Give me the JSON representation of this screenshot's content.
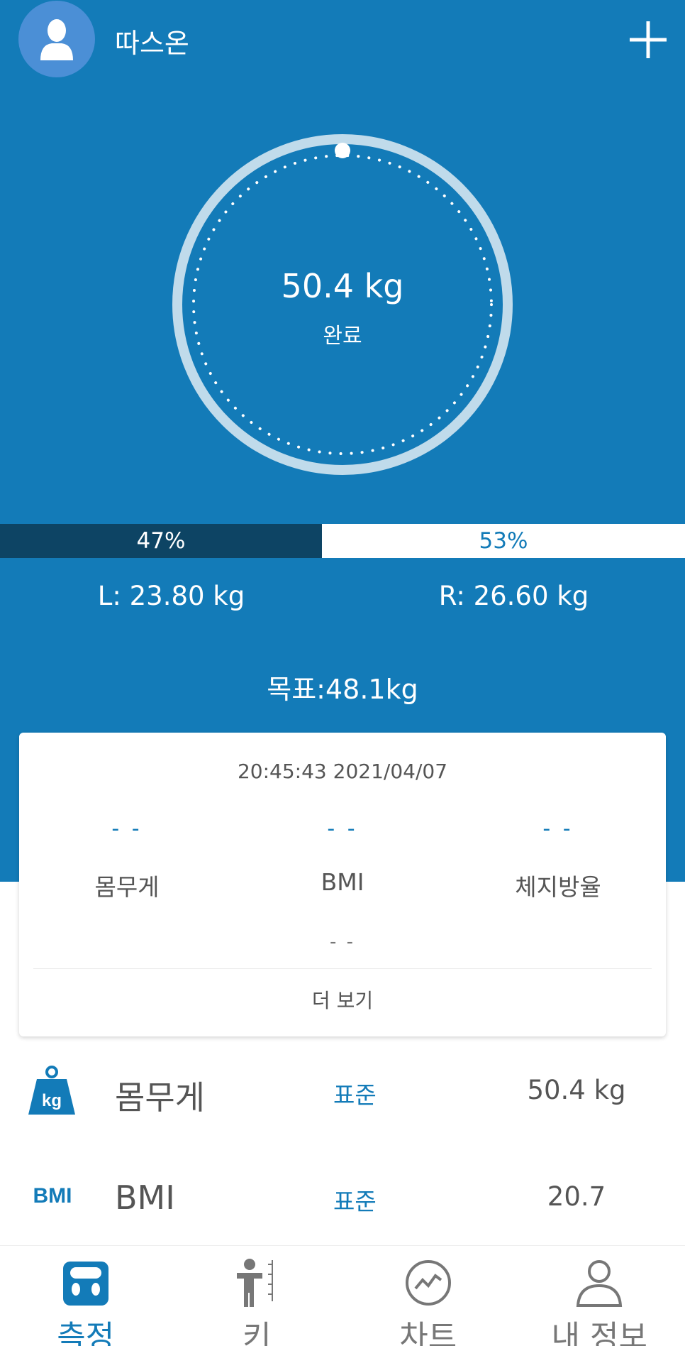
{
  "header": {
    "username": "따스온",
    "add_icon": "plus-icon",
    "avatar_icon": "person-silhouette-icon"
  },
  "measurement": {
    "weight": "50.4 kg",
    "status": "완료",
    "left_percent": "47%",
    "right_percent": "53%",
    "left_fraction": 0.47,
    "left_weight": "L: 23.80 kg",
    "right_weight": "R: 26.60 kg",
    "goal": "목표:48.1kg"
  },
  "card": {
    "timestamp": "20:45:43 2021/04/07",
    "columns": [
      {
        "value": "- -",
        "label": "몸무게"
      },
      {
        "value": "- -",
        "label": "BMI"
      },
      {
        "value": "- -",
        "label": "체지방율"
      }
    ],
    "extra": "- -",
    "more": "더 보기"
  },
  "metrics": [
    {
      "icon": "kg-weight-icon",
      "name": "몸무게",
      "status": "표준",
      "value": "50.4 kg"
    },
    {
      "icon": "bmi-icon",
      "icon_text": "BMI",
      "name": "BMI",
      "status": "표준",
      "value": "20.7"
    }
  ],
  "nav": [
    {
      "label": "측정",
      "icon": "scale-icon",
      "active": true
    },
    {
      "label": "키",
      "icon": "height-icon",
      "active": false
    },
    {
      "label": "차트",
      "icon": "chart-icon",
      "active": false
    },
    {
      "label": "내 정보",
      "icon": "profile-icon",
      "active": false
    }
  ],
  "colors": {
    "primary": "#137bb8",
    "dark": "#0d4464",
    "avatar": "#4b8fd6",
    "ring": "#c0dbeb",
    "text_gray": "#555555"
  }
}
